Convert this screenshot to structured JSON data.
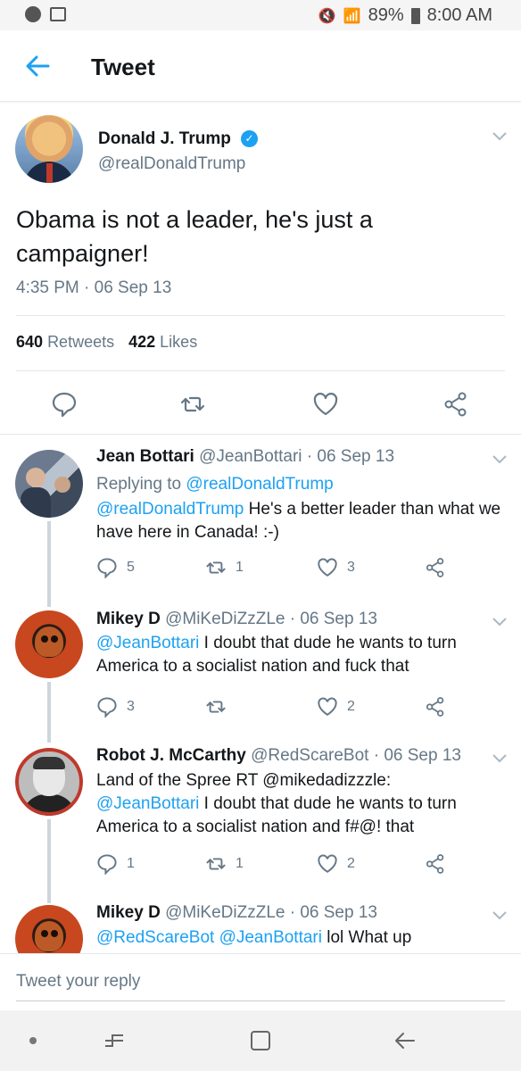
{
  "status_bar": {
    "battery": "89%",
    "time": "8:00 AM"
  },
  "app_bar": {
    "title": "Tweet"
  },
  "main_tweet": {
    "author_name": "Donald J. Trump",
    "author_handle": "@realDonaldTrump",
    "text": "Obama is not a leader, he's just a campaigner!",
    "timestamp": "4:35 PM · 06 Sep 13",
    "retweets_count": "640",
    "retweets_label": "Retweets",
    "likes_count": "422",
    "likes_label": "Likes"
  },
  "replies": [
    {
      "name": "Jean Bottari",
      "handle_date": "@JeanBottari · 06 Sep 13",
      "replying_prefix": "Replying to",
      "replying_to": "@realDonaldTrump",
      "mention": "@realDonaldTrump",
      "text": " He's a better leader than what we have here in Canada! :-)",
      "reply_count": "5",
      "retweet_count": "1",
      "like_count": "3"
    },
    {
      "name": "Mikey D",
      "handle_date": "@MiKeDiZzZLe · 06 Sep 13",
      "mention": "@JeanBottari",
      "text": " I doubt that dude he wants to turn America to a socialist nation and fuck that",
      "reply_count": "3",
      "retweet_count": "",
      "like_count": "2"
    },
    {
      "name": "Robot J. McCarthy",
      "handle_date": "@RedScareBot · 06 Sep 13",
      "pre_text": "Land of the Spree RT @mikedadizzzle:",
      "mention": "@JeanBottari",
      "text": " I doubt that dude he wants to turn America to a socialist nation and f#@! that",
      "reply_count": "1",
      "retweet_count": "1",
      "like_count": "2"
    },
    {
      "name": "Mikey D",
      "handle_date": "@MiKeDiZzZLe · 06 Sep 13",
      "mention1": "@RedScareBot",
      "mention2": "@JeanBottari",
      "text": " lol What up"
    }
  ],
  "reply_bar": {
    "placeholder": "Tweet your reply"
  },
  "icons": {
    "accent": "#1da1f2",
    "muted": "#657786"
  }
}
